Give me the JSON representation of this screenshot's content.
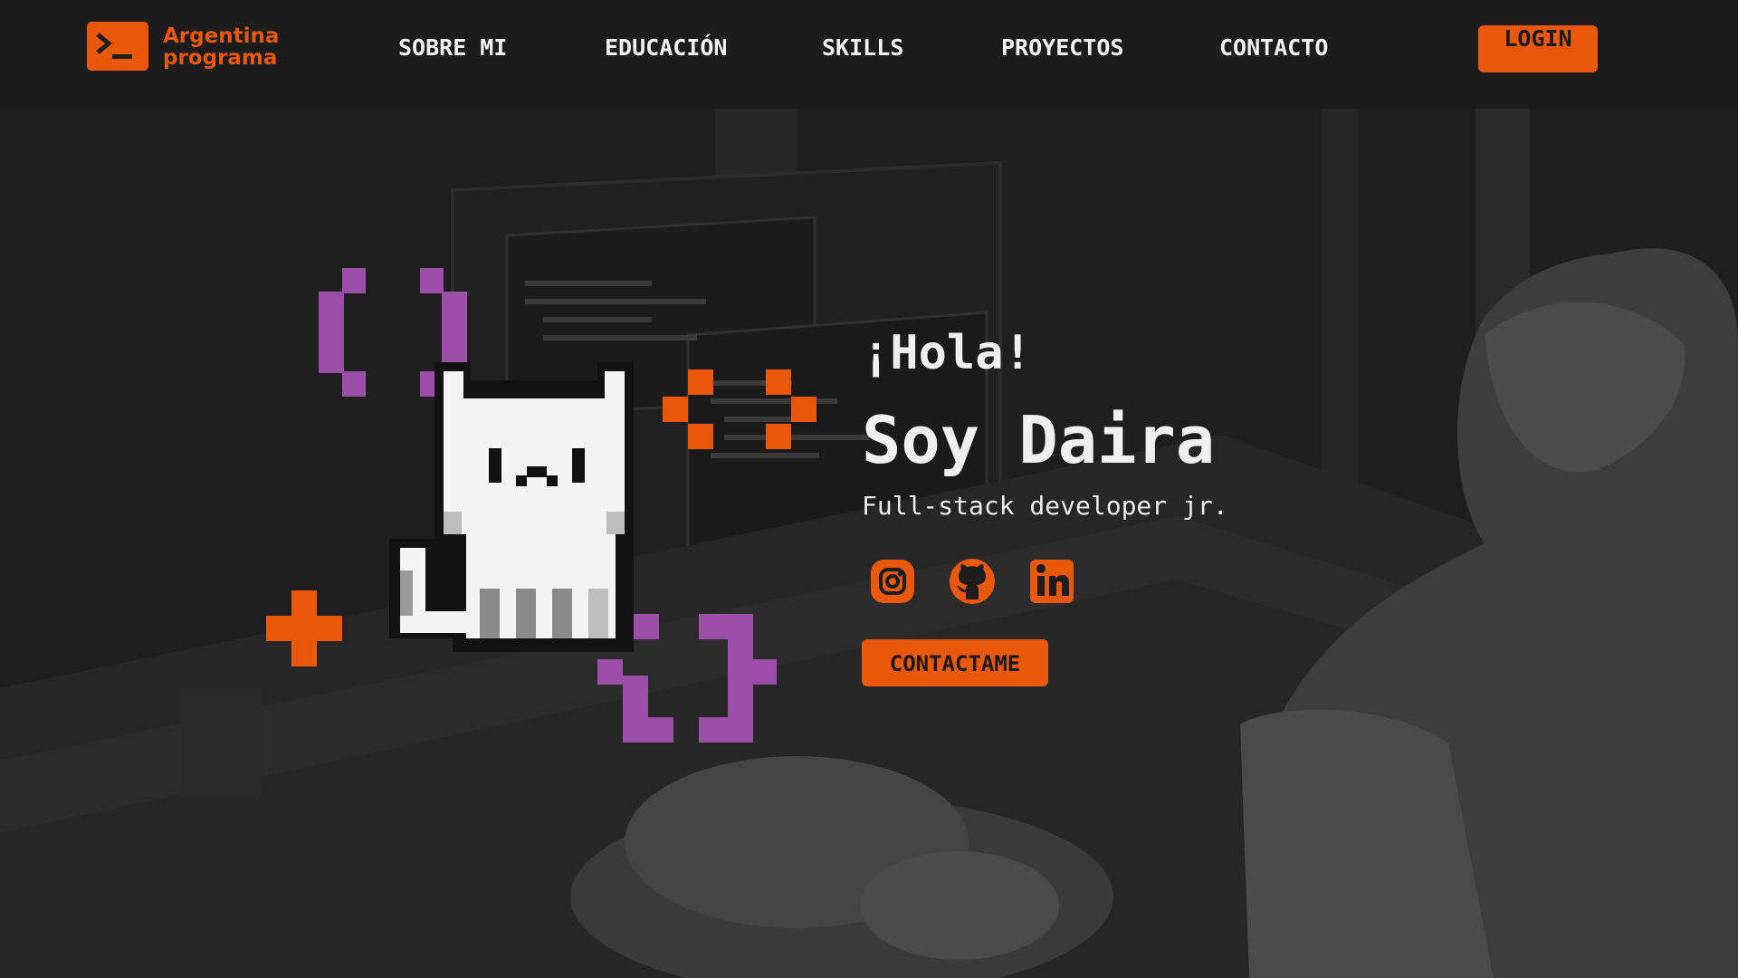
{
  "colors": {
    "accent": "#ea580c",
    "purple": "#9b4fa8",
    "background": "#1d1d1d",
    "text": "#f0f0f0"
  },
  "brand": {
    "logo_icon": "terminal-prompt-icon",
    "name_line1": "Argentina",
    "name_line2": "programa"
  },
  "nav": {
    "links": [
      "SOBRE MI",
      "EDUCACIÓN",
      "SKILLS",
      "PROYECTOS",
      "CONTACTO"
    ],
    "login_label": "LOGIN"
  },
  "hero": {
    "greeting": "¡Hola!",
    "name": "Soy Daira",
    "role": "Full-stack developer jr.",
    "socials": [
      "instagram-icon",
      "github-icon",
      "linkedin-icon"
    ],
    "cta_label": "CONTACTAME"
  }
}
